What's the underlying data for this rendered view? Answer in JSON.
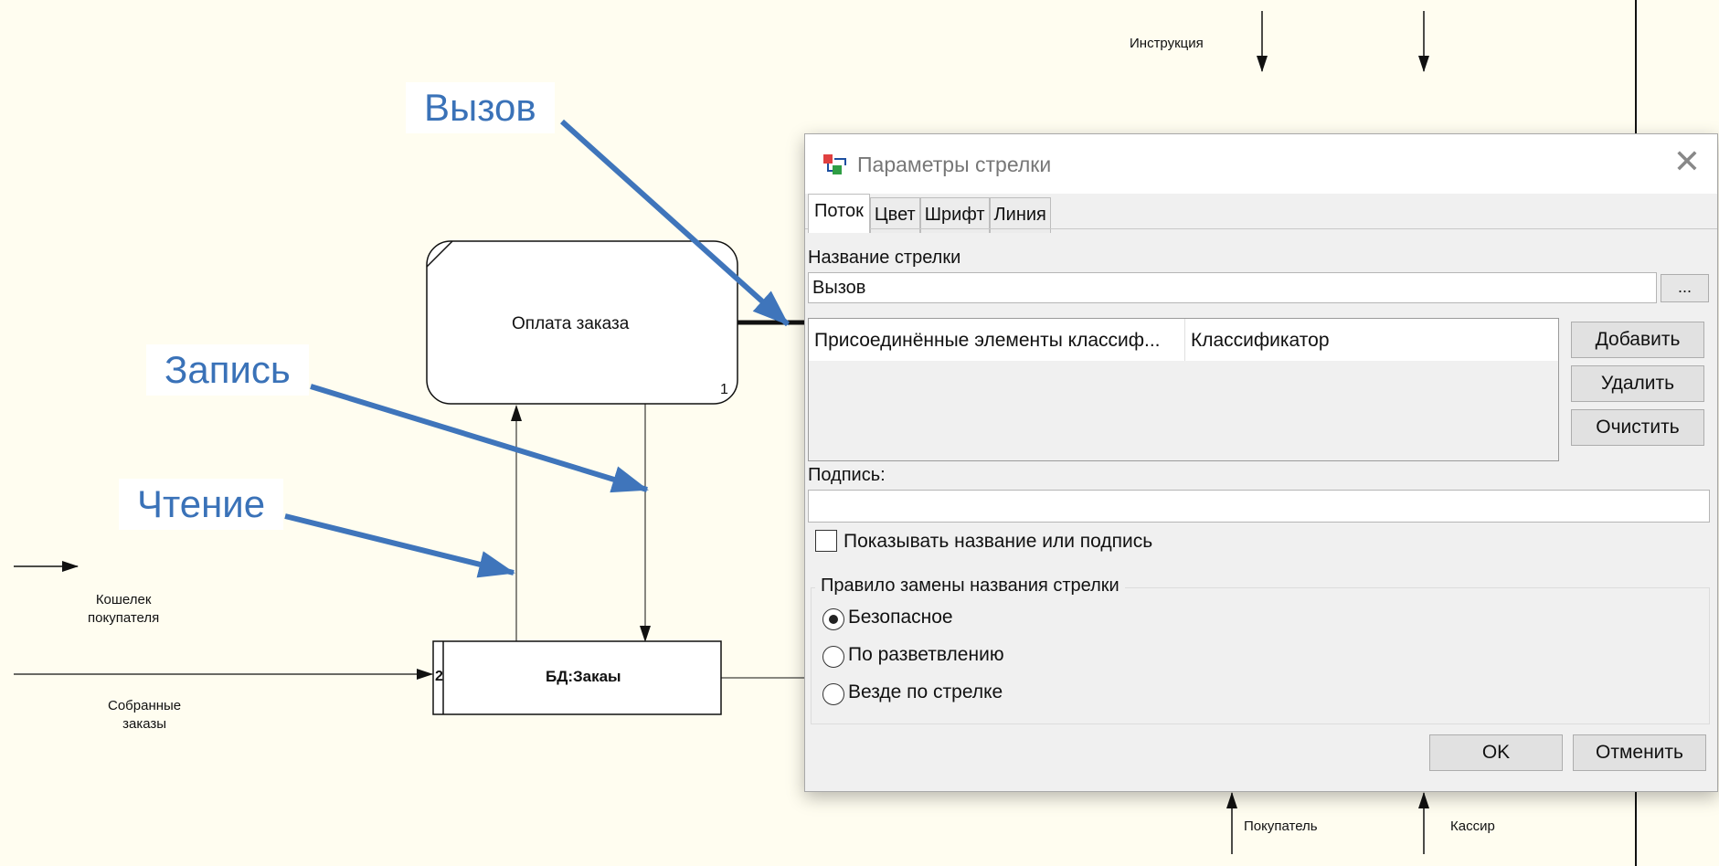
{
  "diagram": {
    "process_box": {
      "title": "Оплата заказа",
      "number": "1"
    },
    "datastore_box": {
      "title": "БД:Закаы",
      "number": "2"
    },
    "arrow_labels": {
      "instruction": "Инструкция",
      "wallet": "Кошелек\nпокупателя",
      "collected_orders": "Собранные\nзаказы",
      "buyer": "Покупатель",
      "cashier": "Кассир"
    },
    "callouts": {
      "call": "Вызов",
      "write": "Запись",
      "read": "Чтение"
    },
    "colors": {
      "background": "#fffdf0",
      "callout_text": "#3a72b8",
      "callout_arrow": "#3f75bb"
    }
  },
  "dialog": {
    "title": "Параметры стрелки",
    "title_icon": "arrow-properties-icon",
    "close_icon": "close-icon",
    "tabs": [
      {
        "label": "Поток",
        "active": true
      },
      {
        "label": "Цвет",
        "active": false
      },
      {
        "label": "Шрифт",
        "active": false
      },
      {
        "label": "Линия",
        "active": false
      }
    ],
    "name_label": "Название стрелки",
    "name_value": "Вызов",
    "browse_label": "...",
    "list": {
      "columns": [
        "Присоединённые элементы классиф...",
        "Классификатор"
      ],
      "rows": []
    },
    "buttons": {
      "add": "Добавить",
      "remove": "Удалить",
      "clear": "Очистить",
      "ok": "OK",
      "cancel": "Отменить"
    },
    "caption_label": "Подпись:",
    "caption_value": "",
    "show_checkbox": {
      "label": "Показывать название или подпись",
      "checked": false
    },
    "rename_group": {
      "title": "Правило замены названия стрелки",
      "options": [
        {
          "label": "Безопасное",
          "checked": true
        },
        {
          "label": "По разветвлению",
          "checked": false
        },
        {
          "label": "Везде по стрелке",
          "checked": false
        }
      ]
    }
  }
}
